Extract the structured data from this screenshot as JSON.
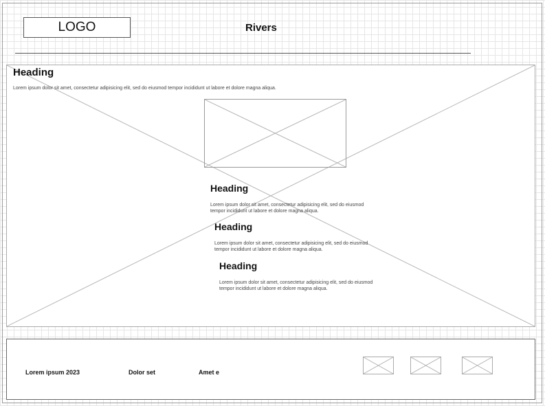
{
  "header": {
    "logo_label": "LOGO",
    "site_title": "Rivers"
  },
  "hero": {
    "heading": "Heading",
    "text": "Lorem ipsum dolor sit amet, consectetur adipisicing elit, sed do eiusmod tempor incididunt ut labore et dolore magna aliqua."
  },
  "cards": [
    {
      "heading": "Heading",
      "text": "Lorem ipsum dolor sit amet, consectetur adipisicing elit, sed do eiusmod tempor incididunt ut labore et dolore magna aliqua."
    },
    {
      "heading": "Heading",
      "text": "Lorem ipsum dolor sit amet, consectetur adipisicing elit, sed do eiusmod tempor incididunt ut labore et dolore magna aliqua."
    },
    {
      "heading": "Heading",
      "text": "Lorem ipsum dolor sit amet, consectetur adipisicing elit, sed do eiusmod tempor incididunt ut labore et dolore magna aliqua."
    }
  ],
  "footer": {
    "copyright": "Lorem ipsum 2023",
    "link_1": "Dolor set",
    "link_2": "Amet e"
  }
}
